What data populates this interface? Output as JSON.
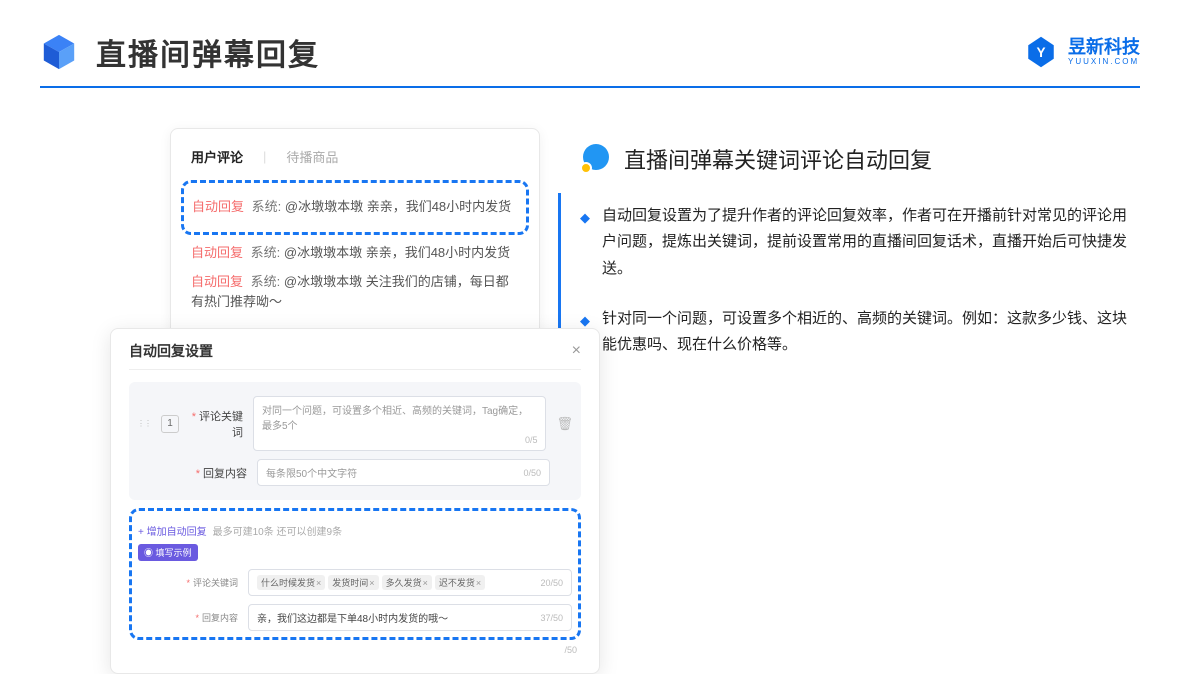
{
  "header": {
    "title": "直播间弹幕回复",
    "brand_name": "昱新科技",
    "brand_sub": "YUUXIN.COM"
  },
  "comments": {
    "tab_active": "用户评论",
    "tab_inactive": "待播商品",
    "tag": "自动回复",
    "sys_prefix": "系统:",
    "c1": "@冰墩墩本墩 亲亲，我们48小时内发货",
    "c2": "@冰墩墩本墩 亲亲，我们48小时内发货",
    "c3": "@冰墩墩本墩 关注我们的店铺，每日都有热门推荐呦～"
  },
  "settings": {
    "title": "自动回复设置",
    "close": "×",
    "num": "1",
    "label_keyword": "评论关键词",
    "placeholder_keyword": "对同一个问题，可设置多个相近、高频的关键词，Tag确定，最多5个",
    "count_keyword": "0/5",
    "label_content": "回复内容",
    "placeholder_content": "每条限50个中文字符",
    "count_content": "0/50",
    "add_link": "+ 增加自动回复",
    "add_hint": "最多可建10条 还可以创建9条",
    "example_badge": "◉ 填写示例",
    "ex_tags": [
      "什么时候发货",
      "发货时间",
      "多久发货",
      "迟不发货"
    ],
    "ex_count_tag": "20/50",
    "ex_reply": "亲，我们这边都是下单48小时内发货的哦～",
    "ex_count_reply": "37/50",
    "ex_count_last": "/50"
  },
  "right": {
    "section_title": "直播间弹幕关键词评论自动回复",
    "b1": "自动回复设置为了提升作者的评论回复效率，作者可在开播前针对常见的评论用户问题，提炼出关键词，提前设置常用的直播间回复话术，直播开始后可快捷发送。",
    "b2": "针对同一个问题，可设置多个相近的、高频的关键词。例如：这款多少钱、这块能优惠吗、现在什么价格等。"
  }
}
